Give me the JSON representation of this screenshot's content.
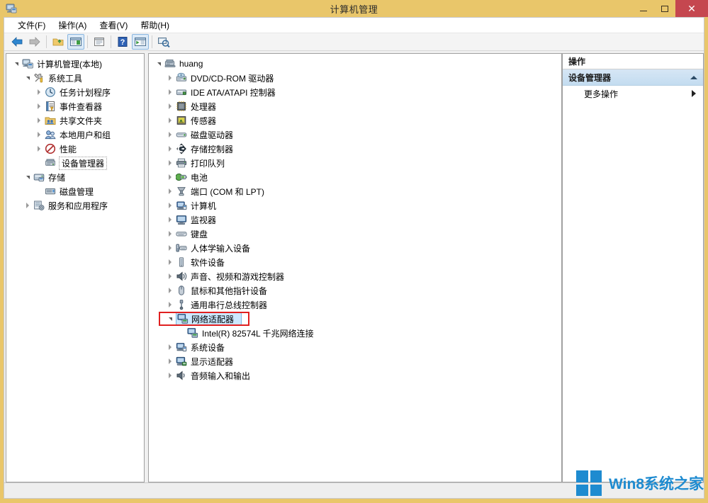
{
  "window": {
    "title": "计算机管理",
    "icon": "computer-management-icon",
    "controls": {
      "minimize": "–",
      "maximize": "□",
      "close": "✕"
    },
    "colors": {
      "titlebar": "#e9c66a",
      "close_button": "#c5474f",
      "selection_fill": "#cce8ff",
      "selection_border": "#7bb8e0",
      "annotation": "#e02020",
      "watermark": "#1e8bd0",
      "action_section": "#c3dcf0"
    }
  },
  "menubar": {
    "items": [
      {
        "label": "文件(F)",
        "name": "menu-file"
      },
      {
        "label": "操作(A)",
        "name": "menu-action"
      },
      {
        "label": "查看(V)",
        "name": "menu-view"
      },
      {
        "label": "帮助(H)",
        "name": "menu-help"
      }
    ]
  },
  "toolbar": {
    "buttons": [
      {
        "icon": "back-arrow-icon",
        "pressed": false
      },
      {
        "icon": "forward-arrow-icon",
        "pressed": false
      },
      {
        "icon": "up-one-level-icon",
        "pressed": false
      },
      {
        "icon": "show-console-tree-icon",
        "pressed": true
      },
      {
        "icon": "properties-icon",
        "pressed": false
      },
      {
        "icon": "help-icon",
        "pressed": false
      },
      {
        "icon": "show-action-pane-icon",
        "pressed": true
      },
      {
        "icon": "scan-hardware-changes-icon",
        "pressed": false
      }
    ]
  },
  "console_tree": {
    "items": [
      {
        "label": "计算机管理(本地)",
        "icon": "computer-management-icon",
        "depth": 0,
        "twisty": "expanded",
        "state": "normal"
      },
      {
        "label": "系统工具",
        "icon": "system-tools-icon",
        "depth": 1,
        "twisty": "expanded",
        "state": "normal"
      },
      {
        "label": "任务计划程序",
        "icon": "task-scheduler-icon",
        "depth": 2,
        "twisty": "collapsed",
        "state": "normal"
      },
      {
        "label": "事件查看器",
        "icon": "event-viewer-icon",
        "depth": 2,
        "twisty": "collapsed",
        "state": "normal"
      },
      {
        "label": "共享文件夹",
        "icon": "shared-folders-icon",
        "depth": 2,
        "twisty": "collapsed",
        "state": "normal"
      },
      {
        "label": "本地用户和组",
        "icon": "local-users-groups-icon",
        "depth": 2,
        "twisty": "collapsed",
        "state": "normal"
      },
      {
        "label": "性能",
        "icon": "performance-icon",
        "depth": 2,
        "twisty": "collapsed",
        "state": "normal"
      },
      {
        "label": "设备管理器",
        "icon": "device-manager-icon",
        "depth": 2,
        "twisty": "none",
        "state": "focused"
      },
      {
        "label": "存储",
        "icon": "storage-icon",
        "depth": 1,
        "twisty": "expanded",
        "state": "normal"
      },
      {
        "label": "磁盘管理",
        "icon": "disk-management-icon",
        "depth": 2,
        "twisty": "none",
        "state": "normal"
      },
      {
        "label": "服务和应用程序",
        "icon": "services-applications-icon",
        "depth": 1,
        "twisty": "collapsed",
        "state": "normal"
      }
    ]
  },
  "device_tree": {
    "items": [
      {
        "label": "huang",
        "icon": "computer-root-icon",
        "depth": 0,
        "twisty": "expanded",
        "state": "normal"
      },
      {
        "label": "DVD/CD-ROM 驱动器",
        "icon": "dvd-drive-icon",
        "depth": 1,
        "twisty": "collapsed",
        "state": "normal"
      },
      {
        "label": "IDE ATA/ATAPI 控制器",
        "icon": "ide-controller-icon",
        "depth": 1,
        "twisty": "collapsed",
        "state": "normal"
      },
      {
        "label": "处理器",
        "icon": "processor-icon",
        "depth": 1,
        "twisty": "collapsed",
        "state": "normal"
      },
      {
        "label": "传感器",
        "icon": "sensor-icon",
        "depth": 1,
        "twisty": "collapsed",
        "state": "normal"
      },
      {
        "label": "磁盘驱动器",
        "icon": "disk-drive-icon",
        "depth": 1,
        "twisty": "collapsed",
        "state": "normal"
      },
      {
        "label": "存储控制器",
        "icon": "storage-controller-icon",
        "depth": 1,
        "twisty": "collapsed",
        "state": "normal"
      },
      {
        "label": "打印队列",
        "icon": "print-queue-icon",
        "depth": 1,
        "twisty": "collapsed",
        "state": "normal"
      },
      {
        "label": "电池",
        "icon": "battery-icon",
        "depth": 1,
        "twisty": "collapsed",
        "state": "normal"
      },
      {
        "label": "端口 (COM 和 LPT)",
        "icon": "ports-icon",
        "depth": 1,
        "twisty": "collapsed",
        "state": "normal"
      },
      {
        "label": "计算机",
        "icon": "computer-icon",
        "depth": 1,
        "twisty": "collapsed",
        "state": "normal"
      },
      {
        "label": "监视器",
        "icon": "monitor-icon",
        "depth": 1,
        "twisty": "collapsed",
        "state": "normal"
      },
      {
        "label": "键盘",
        "icon": "keyboard-icon",
        "depth": 1,
        "twisty": "collapsed",
        "state": "normal"
      },
      {
        "label": "人体学输入设备",
        "icon": "hid-icon",
        "depth": 1,
        "twisty": "collapsed",
        "state": "normal"
      },
      {
        "label": "软件设备",
        "icon": "software-device-icon",
        "depth": 1,
        "twisty": "collapsed",
        "state": "normal"
      },
      {
        "label": "声音、视频和游戏控制器",
        "icon": "sound-video-game-icon",
        "depth": 1,
        "twisty": "collapsed",
        "state": "normal"
      },
      {
        "label": "鼠标和其他指针设备",
        "icon": "mouse-icon",
        "depth": 1,
        "twisty": "collapsed",
        "state": "normal"
      },
      {
        "label": "通用串行总线控制器",
        "icon": "usb-controller-icon",
        "depth": 1,
        "twisty": "collapsed",
        "state": "normal"
      },
      {
        "label": "网络适配器",
        "icon": "network-adapter-icon",
        "depth": 1,
        "twisty": "expanded",
        "state": "selected",
        "annotated": true
      },
      {
        "label": "Intel(R) 82574L 千兆网络连接",
        "icon": "network-adapter-icon",
        "depth": 2,
        "twisty": "none",
        "state": "normal"
      },
      {
        "label": "系统设备",
        "icon": "system-device-icon",
        "depth": 1,
        "twisty": "collapsed",
        "state": "normal"
      },
      {
        "label": "显示适配器",
        "icon": "display-adapter-icon",
        "depth": 1,
        "twisty": "collapsed",
        "state": "normal"
      },
      {
        "label": "音频输入和输出",
        "icon": "audio-io-icon",
        "depth": 1,
        "twisty": "collapsed",
        "state": "normal"
      }
    ]
  },
  "actions_pane": {
    "header": "操作",
    "section": {
      "label": "设备管理器",
      "collapse_icon": "caret-up-icon"
    },
    "rows": [
      {
        "label": "更多操作",
        "submenu_icon": "caret-right-icon"
      }
    ]
  },
  "statusbar": {
    "text": ""
  },
  "watermark": {
    "text": "Win8系统之家",
    "logo": "windows-logo-icon"
  }
}
